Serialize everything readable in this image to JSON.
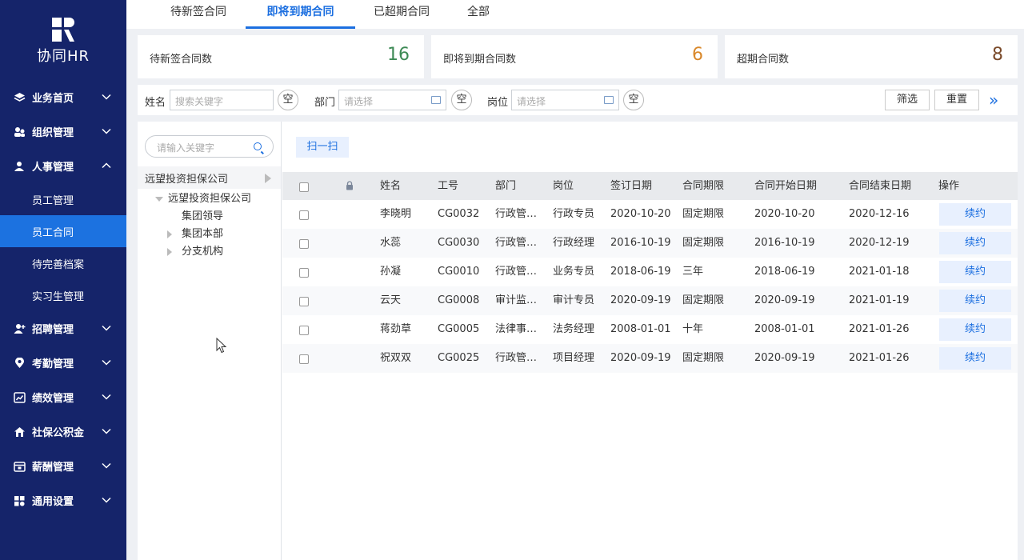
{
  "app": {
    "logo_text": "协同HR"
  },
  "sidebar": {
    "items": [
      {
        "label": "业务首页",
        "icon": "layers-icon",
        "expanded": false
      },
      {
        "label": "组织管理",
        "icon": "org-icon",
        "expanded": false
      },
      {
        "label": "人事管理",
        "icon": "person-icon",
        "expanded": true
      },
      {
        "label": "招聘管理",
        "icon": "person-add-icon",
        "expanded": false
      },
      {
        "label": "考勤管理",
        "icon": "location-icon",
        "expanded": false
      },
      {
        "label": "绩效管理",
        "icon": "chart-icon",
        "expanded": false
      },
      {
        "label": "社保公积金",
        "icon": "house-icon",
        "expanded": false
      },
      {
        "label": "薪酬管理",
        "icon": "wallet-icon",
        "expanded": false
      },
      {
        "label": "通用设置",
        "icon": "grid-icon",
        "expanded": false
      }
    ],
    "sub_items": [
      {
        "label": "员工管理",
        "active": false
      },
      {
        "label": "员工合同",
        "active": true
      },
      {
        "label": "待完善档案",
        "active": false
      },
      {
        "label": "实习生管理",
        "active": false
      }
    ]
  },
  "tabs": [
    {
      "label": "待新签合同",
      "active": false
    },
    {
      "label": "即将到期合同",
      "active": true
    },
    {
      "label": "已超期合同",
      "active": false
    },
    {
      "label": "全部",
      "active": false
    }
  ],
  "stats": [
    {
      "label": "待新签合同数",
      "value": "16",
      "color": "#3d8a55"
    },
    {
      "label": "即将到期合同数",
      "value": "6",
      "color": "#d9882b"
    },
    {
      "label": "超期合同数",
      "value": "8",
      "color": "#7a4a2a"
    }
  ],
  "filter": {
    "name_label": "姓名",
    "name_placeholder": "搜索关键字",
    "dept_label": "部门",
    "dept_placeholder": "请选择",
    "post_label": "岗位",
    "post_placeholder": "请选择",
    "clear_label": "空",
    "filter_button": "筛选",
    "reset_button": "重置",
    "more_label": "»"
  },
  "tree": {
    "search_placeholder": "请输入关键字",
    "root": "远望投资担保公司",
    "nodes": [
      {
        "label": "远望投资担保公司",
        "level": 1,
        "arrow": "down"
      },
      {
        "label": "集团领导",
        "level": 2,
        "arrow": "none"
      },
      {
        "label": "集团本部",
        "level": 2,
        "arrow": "right"
      },
      {
        "label": "分支机构",
        "level": 2,
        "arrow": "right"
      }
    ]
  },
  "toolbar": {
    "scan_label": "扫一扫"
  },
  "table": {
    "columns": [
      "姓名",
      "工号",
      "部门",
      "岗位",
      "签订日期",
      "合同期限",
      "合同开始日期",
      "合同结束日期",
      "操作"
    ],
    "action_label": "续约",
    "rows": [
      {
        "name": "李晓明",
        "id": "CG0032",
        "dept": "行政管…",
        "post": "行政专员",
        "sign": "2020-10-20",
        "term": "固定期限",
        "start": "2020-10-20",
        "end": "2020-12-16"
      },
      {
        "name": "水蕊",
        "id": "CG0030",
        "dept": "行政管…",
        "post": "行政经理",
        "sign": "2016-10-19",
        "term": "固定期限",
        "start": "2016-10-19",
        "end": "2020-12-19"
      },
      {
        "name": "孙凝",
        "id": "CG0010",
        "dept": "行政管…",
        "post": "业务专员",
        "sign": "2018-06-19",
        "term": "三年",
        "start": "2018-06-19",
        "end": "2021-01-18"
      },
      {
        "name": "云天",
        "id": "CG0008",
        "dept": "审计监…",
        "post": "审计专员",
        "sign": "2020-09-19",
        "term": "固定期限",
        "start": "2020-09-19",
        "end": "2021-01-19"
      },
      {
        "name": "蒋劲草",
        "id": "CG0005",
        "dept": "法律事…",
        "post": "法务经理",
        "sign": "2008-01-01",
        "term": "十年",
        "start": "2008-01-01",
        "end": "2021-01-26"
      },
      {
        "name": "祝双双",
        "id": "CG0025",
        "dept": "行政管…",
        "post": "项目经理",
        "sign": "2020-09-19",
        "term": "固定期限",
        "start": "2020-09-19",
        "end": "2021-01-26"
      }
    ]
  },
  "colors": {
    "sidebar_bg": "#15246a",
    "accent": "#1c6fe0"
  }
}
